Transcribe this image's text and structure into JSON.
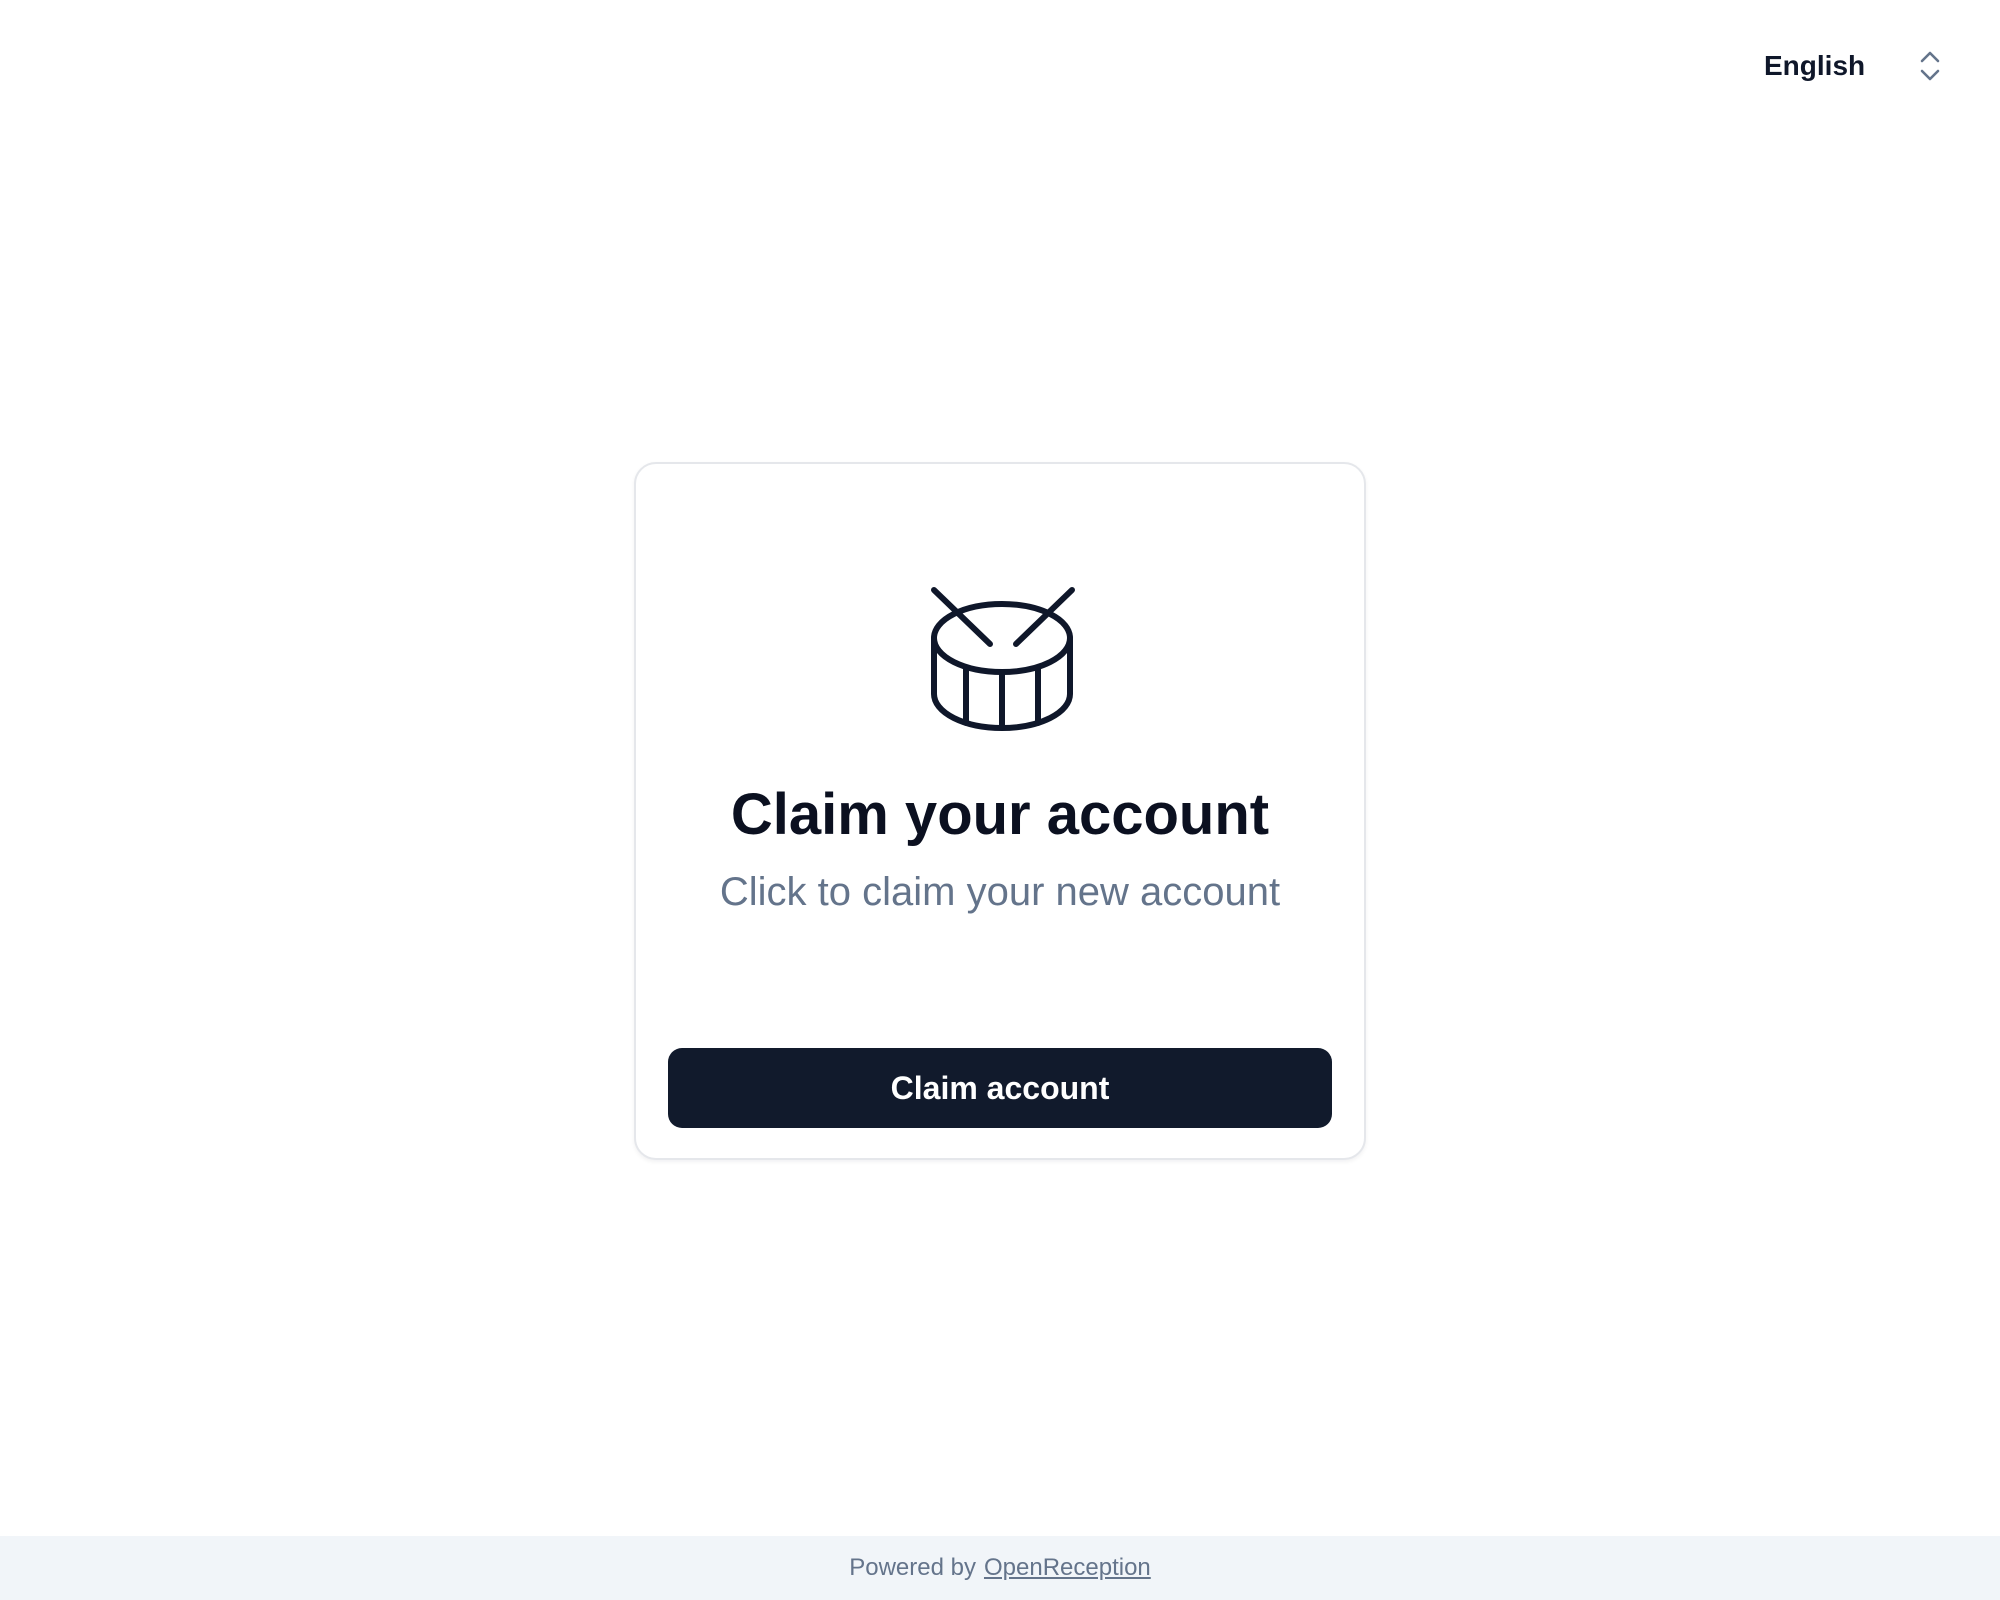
{
  "language_selector": {
    "value": "English",
    "icon": "chevron-up-down-icon"
  },
  "card": {
    "logo_icon": "drum-icon",
    "title": "Claim your account",
    "subtitle": "Click to claim your new account",
    "button_label": "Claim account"
  },
  "footer": {
    "prefix": "Powered by",
    "link_text": "OpenReception"
  },
  "colors": {
    "button_bg": "#111a2c",
    "subtitle": "#64748b",
    "footer_bg": "#f1f5f9",
    "border": "#e5e7eb"
  }
}
